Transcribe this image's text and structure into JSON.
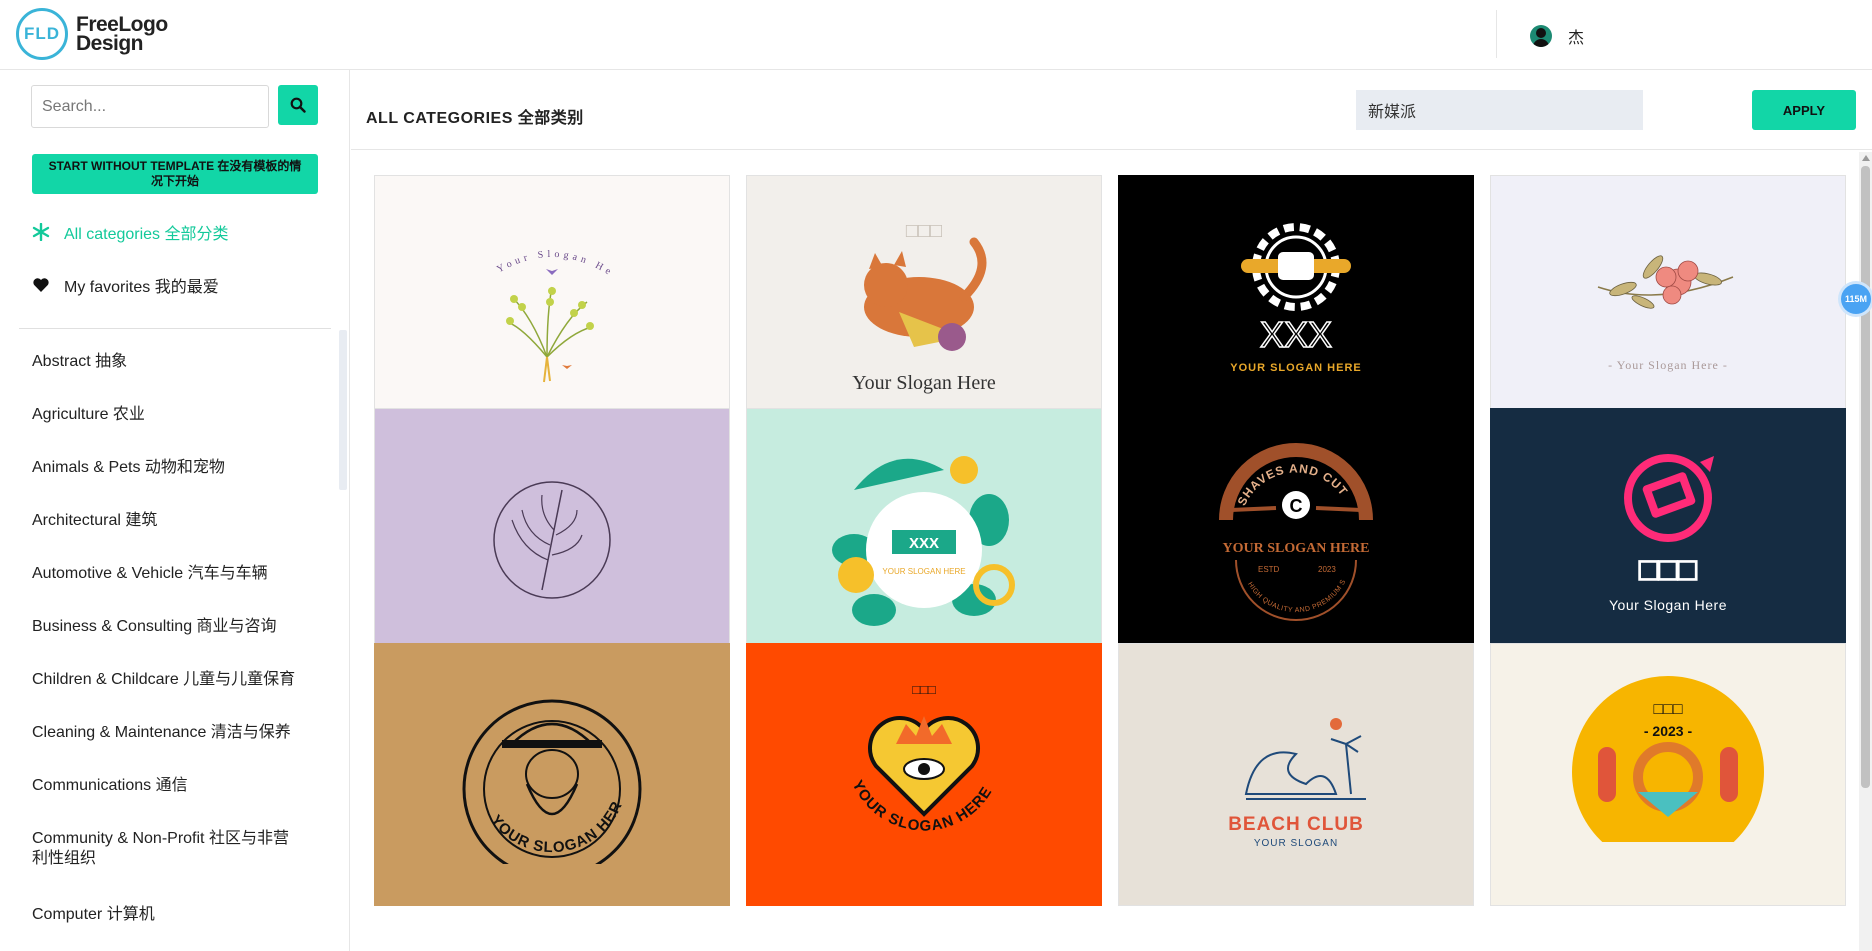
{
  "header": {
    "logo_mark": "FLD",
    "logo_line1": "FreeLogo",
    "logo_line2": "Design",
    "user_name": "杰"
  },
  "sidebar": {
    "search_placeholder": "Search...",
    "start_button": "START WITHOUT TEMPLATE 在没有模板的情况下开始",
    "all_categories": "All categories 全部分类",
    "favorites": "My favorites 我的最爱",
    "categories": [
      "Abstract 抽象",
      "Agriculture 农业",
      "Animals & Pets 动物和宠物",
      "Architectural 建筑",
      "Automotive & Vehicle 汽车与车辆",
      "Business & Consulting 商业与咨询",
      "Children & Childcare 儿童与儿童保育",
      "Cleaning & Maintenance 清洁与保养",
      "Communications 通信",
      "Community & Non-Profit 社区与非营利性组织",
      "Computer 计算机"
    ]
  },
  "main": {
    "title": "ALL CATEGORIES 全部类别",
    "filter_value": "新媒派",
    "apply_label": "APPLY",
    "badge": "115M",
    "cards": [
      {
        "name": "flower-bouquet-logo",
        "bg": "#fbf8f6",
        "text": "Your Slogan Here"
      },
      {
        "name": "cat-logo",
        "bg": "#f2efeb",
        "text": "Your Slogan Here"
      },
      {
        "name": "gear-fist-logo",
        "bg": "#000000",
        "text": "YOUR SLOGAN HERE"
      },
      {
        "name": "hibiscus-logo",
        "bg": "#f0f0f8",
        "text": "- Your Slogan Here -"
      },
      {
        "name": "leaf-circle-logo",
        "bg": "#cfbfdc",
        "text": ""
      },
      {
        "name": "tropical-logo",
        "bg": "#c6ecdf",
        "text": "YOUR SLOGAN HERE"
      },
      {
        "name": "barber-logo",
        "bg": "#000000",
        "text": "YOUR SLOGAN HERE"
      },
      {
        "name": "laptop-logo",
        "bg": "#152c42",
        "text": "Your Slogan Here"
      },
      {
        "name": "bearded-man-logo",
        "bg": "#c99b60",
        "text": "YOUR SLOGAN HERE"
      },
      {
        "name": "heart-eye-logo",
        "bg": "#ff4a00",
        "text": "YOUR SLOGAN HERE"
      },
      {
        "name": "beach-club-logo",
        "bg": "#e7e1d8",
        "text": "BEACH CLUB"
      },
      {
        "name": "pretzel-logo",
        "bg": "#f6f2e8",
        "text": "- 2023 -"
      }
    ],
    "card_texts": {
      "xxx": "XXX",
      "estd": "ESTD",
      "year": "2023",
      "shaves": "SHAVES AND CUT",
      "quality": "HIGH QUALITY AND PREMIUM SERVICE",
      "your_slogan": "YOUR SLOGAN"
    }
  }
}
